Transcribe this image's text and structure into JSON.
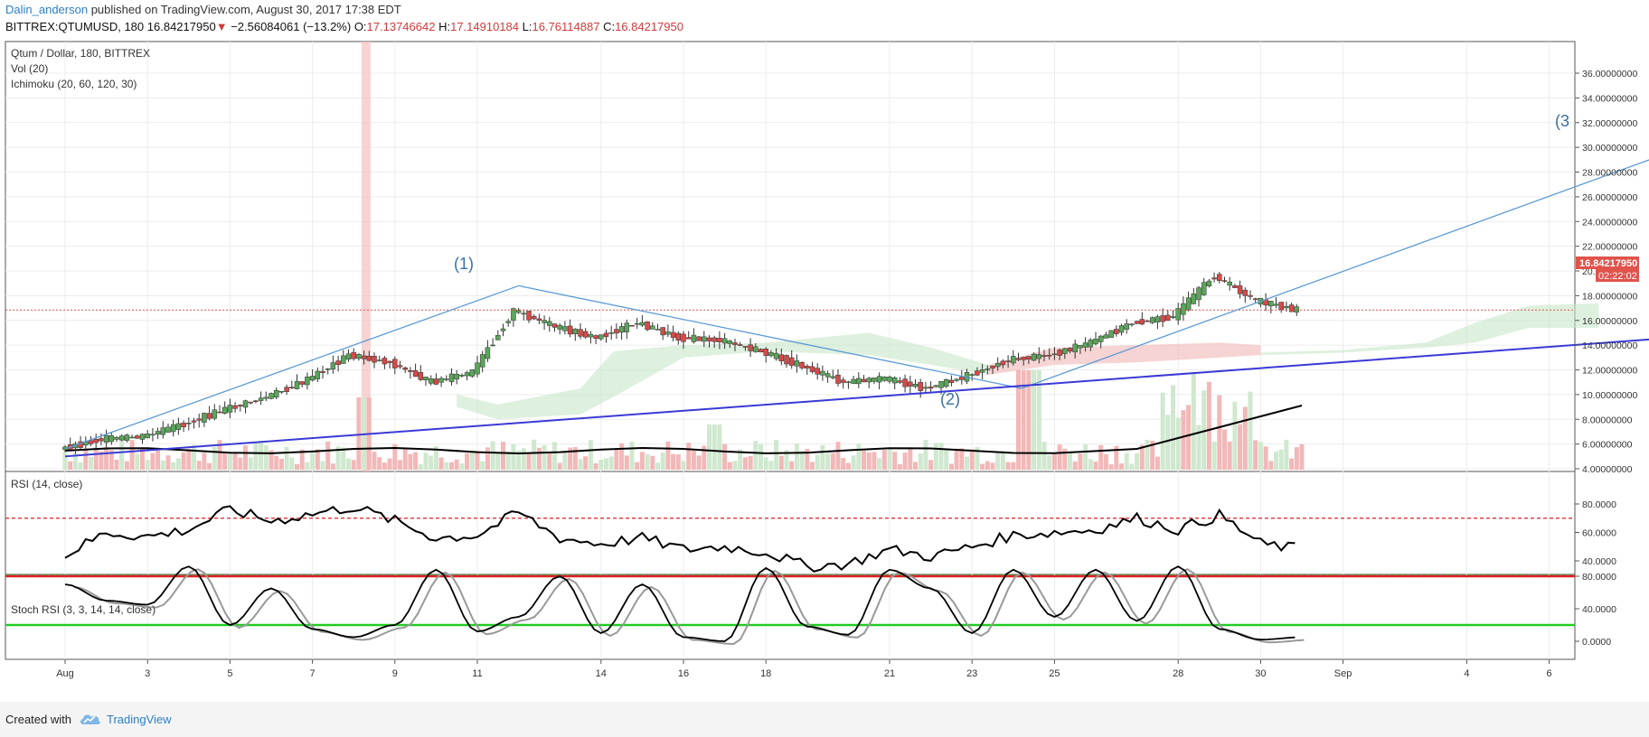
{
  "header": {
    "author": "Dalin_anderson",
    "published": "published on TradingView.com, August 30, 2017 17:38 EDT",
    "symbol": "BITTREX:QTUMUSD, 180",
    "price": "16.84217950",
    "change": "−2.56084061 (−13.2%)",
    "o_label": "O:",
    "o_val": "17.13746642",
    "h_label": "H:",
    "h_val": "17.14910184",
    "l_label": "L:",
    "l_val": "16.76114887",
    "c_label": "C:",
    "c_val": "16.84217950"
  },
  "legend": {
    "main": "Qtum / Dollar, 180, BITTREX",
    "vol": "Vol (20)",
    "ichimoku": "Ichimoku (20, 60, 120, 30)",
    "rsi": "RSI (14, close)",
    "stoch": "Stoch RSI (3, 3, 14, 14, close)"
  },
  "price_tag": {
    "value": "16.84217950",
    "countdown": "02:22:02",
    "color": "#e0534b"
  },
  "annotations": [
    "(1)",
    "(2)",
    "(3"
  ],
  "colors": {
    "bull": "#5aa55a",
    "bear": "#d64a4a",
    "trend": "#5b9bd5",
    "support": "#3a3ad6",
    "rsi_line": "#000000",
    "stoch_k": "#000000",
    "stoch_d": "#999999",
    "ob": "#e02020",
    "os": "#22cc22"
  },
  "footer": {
    "created": "Created with",
    "brand": "TradingView"
  },
  "chart_data": [
    {
      "type": "line",
      "title": "Qtum / Dollar, 180, BITTREX",
      "ylim": [
        4,
        37
      ],
      "y_ticks": [
        "36.00000000",
        "34.00000000",
        "32.00000000",
        "30.00000000",
        "28.00000000",
        "26.00000000",
        "24.00000000",
        "22.00000000",
        "20.00000000",
        "18.00000000",
        "16.00000000",
        "14.00000000",
        "12.00000000",
        "10.00000000",
        "8.00000000",
        "6.00000000",
        "4.00000000"
      ],
      "x_ticks": [
        "Aug",
        "3",
        "5",
        "7",
        "9",
        "11",
        "14",
        "16",
        "18",
        "21",
        "23",
        "25",
        "28",
        "30",
        "Sep",
        "4",
        "6"
      ],
      "series": [
        {
          "x": [
            0,
            1,
            2,
            3,
            4,
            5,
            6,
            7,
            8,
            9,
            10,
            11,
            12,
            13,
            14,
            15,
            16,
            17,
            18,
            19,
            20,
            21,
            22,
            23,
            24,
            25,
            26,
            27,
            28,
            29,
            30
          ],
          "values": [
            5.6,
            6.4,
            6.6,
            7.6,
            8.8,
            9.8,
            11.2,
            13.2,
            12.6,
            11.0,
            11.8,
            16.8,
            15.5,
            14.6,
            15.8,
            14.6,
            14.4,
            13.5,
            12.3,
            11.0,
            11.3,
            10.5,
            11.5,
            12.8,
            13.2,
            14.2,
            15.8,
            16.3,
            19.6,
            17.6,
            16.84
          ]
        }
      ],
      "trend_lines": [
        {
          "x": [
            0,
            11
          ],
          "y": [
            5.6,
            18.8
          ]
        },
        {
          "x": [
            11,
            23.2
          ],
          "y": [
            18.8,
            10.5
          ]
        },
        {
          "x": [
            23.2,
            38.6
          ],
          "y": [
            10.5,
            29.2
          ]
        },
        {
          "x": [
            0,
            38.6
          ],
          "y": [
            5.0,
            14.5
          ]
        }
      ]
    },
    {
      "type": "line",
      "title": "RSI (14, close)",
      "ylim": [
        20,
        90
      ],
      "y_ticks": [
        "80.0000",
        "60.0000",
        "40.0000"
      ],
      "levels": [
        70,
        30
      ],
      "series": [
        {
          "x": [
            0,
            1,
            2,
            3,
            4,
            5,
            6,
            7,
            8,
            9,
            10,
            11,
            12,
            13,
            14,
            15,
            16,
            17,
            18,
            19,
            20,
            21,
            22,
            23,
            24,
            25,
            26,
            27,
            28,
            29,
            30
          ],
          "values": [
            44,
            60,
            57,
            62,
            76,
            68,
            73,
            78,
            68,
            56,
            58,
            74,
            56,
            52,
            56,
            48,
            50,
            46,
            36,
            38,
            48,
            43,
            50,
            58,
            60,
            62,
            70,
            62,
            72,
            52,
            48
          ]
        }
      ]
    },
    {
      "type": "line",
      "title": "Stoch RSI (3, 3, 14, 14, close)",
      "ylim": [
        -5,
        100
      ],
      "y_ticks": [
        "80.0000",
        "40.0000",
        "0.0000"
      ],
      "levels": [
        80,
        20
      ],
      "series": [
        {
          "x": [
            0,
            1,
            2,
            3,
            4,
            5,
            6,
            7,
            8,
            9,
            10,
            11,
            12,
            13,
            14,
            15,
            16,
            17,
            18,
            19,
            20,
            21,
            22,
            23,
            24,
            25,
            26,
            27,
            28,
            29,
            30
          ],
          "values": [
            70,
            50,
            45,
            92,
            20,
            65,
            15,
            5,
            20,
            88,
            12,
            30,
            80,
            10,
            70,
            5,
            0,
            90,
            18,
            8,
            88,
            65,
            10,
            88,
            30,
            88,
            25,
            92,
            15,
            2,
            5
          ]
        }
      ]
    }
  ]
}
